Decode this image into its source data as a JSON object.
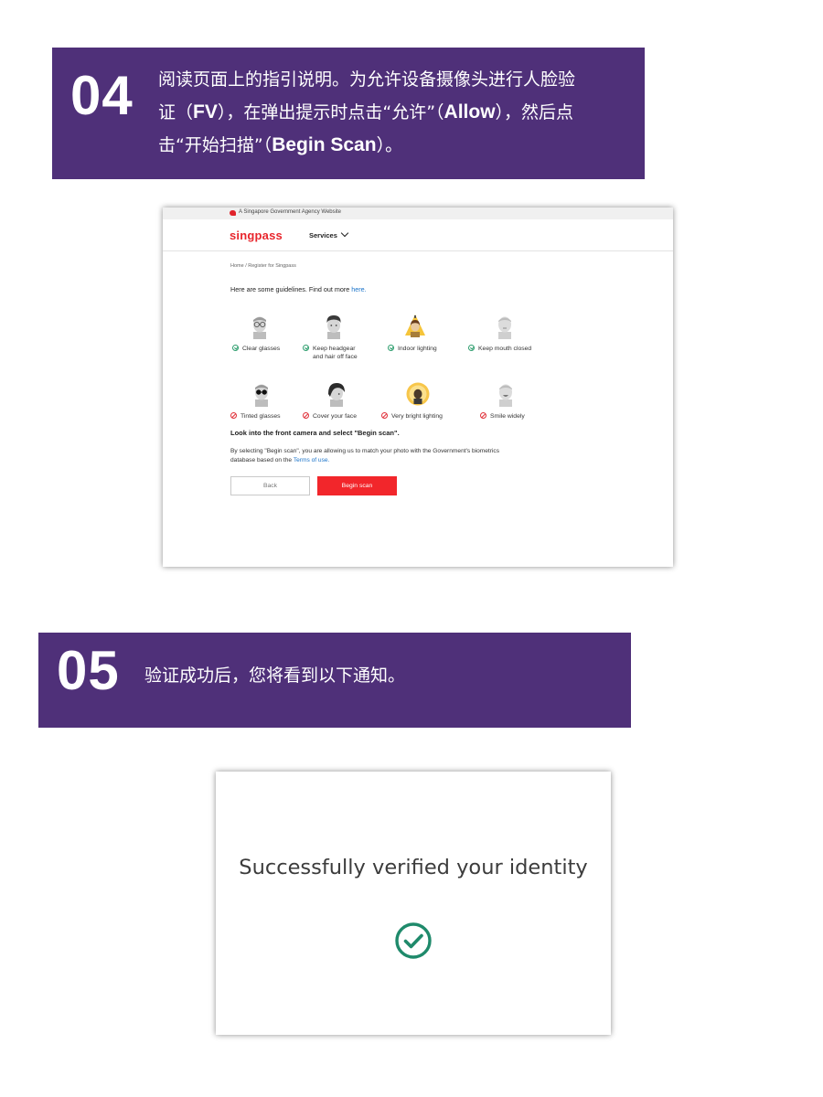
{
  "step4": {
    "number": "04",
    "line1": "阅读页面上的指引说明。为允许设备摄像头进行人脸验",
    "line2_pre": "证（",
    "line2_b1": "FV",
    "line2_mid": "），在弹出提示时点击“允许”（",
    "line2_b2": "Allow",
    "line2_post": "），然后点",
    "line3_pre": "击“开始扫描”（",
    "line3_b": "Begin Scan",
    "line3_post": "）。"
  },
  "screen1": {
    "gov_notice": "A Singapore Government Agency Website",
    "logo": "singpass",
    "nav_services": "Services",
    "breadcrumb": "Home  /  Register for Singpass",
    "intro_text": "Here are some guidelines. Find out more ",
    "intro_link": "here.",
    "do_items": [
      {
        "label": "Clear glasses",
        "icon": "face-clear-glasses-icon"
      },
      {
        "label": "Keep headgear",
        "label2": "and hair off face",
        "icon": "face-no-headgear-icon"
      },
      {
        "label": "Indoor lighting",
        "icon": "face-indoor-lighting-icon"
      },
      {
        "label": "Keep mouth closed",
        "icon": "face-mouth-closed-icon"
      }
    ],
    "dont_items": [
      {
        "label": "Tinted glasses",
        "icon": "face-tinted-glasses-icon"
      },
      {
        "label": "Cover your face",
        "icon": "face-covered-icon"
      },
      {
        "label": "Very bright lighting",
        "icon": "face-bright-light-icon"
      },
      {
        "label": "Smile widely",
        "icon": "face-smile-icon"
      }
    ],
    "camera_instruction": "Look into the front camera and select \"Begin scan\".",
    "consent_line1": "By selecting \"Begin scan\", you are allowing us to match your photo with the Government's biometrics",
    "consent_line2": "database based on the ",
    "terms_link": "Terms of use.",
    "back_label": "Back",
    "scan_label": "Begin scan",
    "colors": {
      "brand_red": "#f2262b",
      "ok_green": "#2e9e6e",
      "link_blue": "#1a73c9"
    }
  },
  "step5": {
    "number": "05",
    "text": "验证成功后，您将看到以下通知。"
  },
  "screen2": {
    "message": "Successfully verified your identity",
    "icon": "check-circle-icon",
    "color": "#1f8a6b"
  },
  "banner_color": "#4f3079"
}
